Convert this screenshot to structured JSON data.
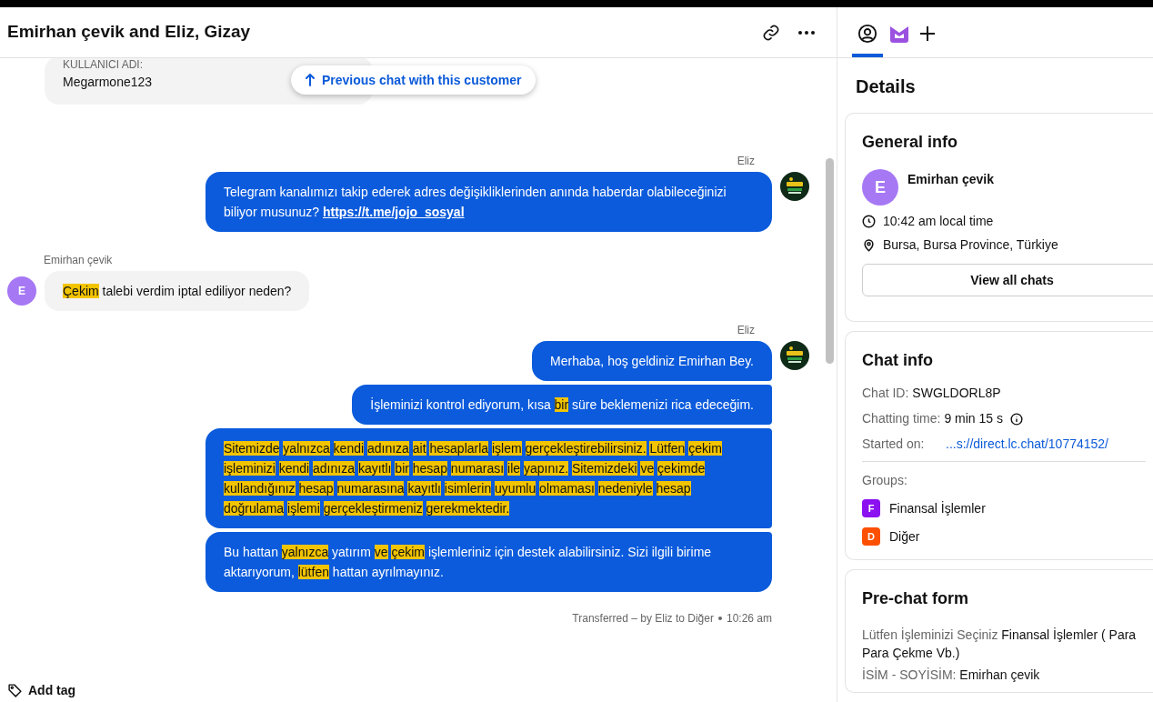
{
  "header": {
    "title": "Emirhan çevik and Eliz, Gizay"
  },
  "previous_message": {
    "label": "KULLANICI ADI:",
    "value": "Megarmone123"
  },
  "previous_chat_button": {
    "label": "Previous chat with this customer"
  },
  "messages": [
    {
      "kind": "agent",
      "author": "Eliz",
      "text": "Telegram kanalımızı takip ederek adres değişikliklerinden anında haberdar olabileceğinizi biliyor musunuz?",
      "link": "https://t.me/jojo_sosyal"
    },
    {
      "kind": "customer",
      "author": "Emirhan çevik",
      "initial": "E",
      "words": [
        {
          "text": "Çekim",
          "highlighted": true
        },
        {
          "text": "talebi",
          "highlighted": false
        },
        {
          "text": "verdim",
          "highlighted": false
        },
        {
          "text": "iptal",
          "highlighted": false
        },
        {
          "text": "ediliyor",
          "highlighted": false
        },
        {
          "text": "neden?",
          "highlighted": false
        }
      ]
    },
    {
      "kind": "agent",
      "author": "Eliz",
      "text": "Merhaba, hoş geldiniz Emirhan Bey."
    },
    {
      "kind": "agent",
      "words": [
        {
          "text": "İşleminizi kontrol ediyorum, kısa",
          "highlighted": false
        },
        {
          "text": "bir",
          "highlighted": true
        },
        {
          "text": "süre beklemenizi rica edeceğim.",
          "highlighted": false
        }
      ]
    },
    {
      "kind": "agent",
      "highlight_all_words": true,
      "text": "Sitemizde yalnızca kendi adınıza ait hesaplarla işlem gerçekleştirebilirsiniz. Lütfen çekim işleminizi kendi adınıza kayıtlı bir hesap numarası ile yapınız. Sitemizdeki ve çekimde kullandığınız hesap numarasına kayıtlı isimlerin uyumlu olmaması nedeniyle hesap doğrulama işlemi gerçekleştirmeniz gerekmektedir."
    },
    {
      "kind": "agent",
      "words": [
        {
          "text": "Bu hattan",
          "highlighted": false
        },
        {
          "text": "yalnızca",
          "highlighted": true
        },
        {
          "text": "yatırım",
          "highlighted": false
        },
        {
          "text": "ve",
          "highlighted": true
        },
        {
          "text": "çekim",
          "highlighted": true
        },
        {
          "text": "işlemleriniz için destek alabilirsiniz. Sizi ilgili birime aktarıyorum,",
          "highlighted": false
        },
        {
          "text": "lütfen",
          "highlighted": true
        },
        {
          "text": "hattan ayrılmayınız.",
          "highlighted": false
        }
      ]
    },
    {
      "kind": "event",
      "text": "Transferred – by Eliz to Diğer",
      "time": "10:26 am"
    }
  ],
  "add_tag": {
    "label": "Add tag"
  },
  "sidebar": {
    "tabs": [
      {
        "kind": "customer",
        "selected": true
      },
      {
        "kind": "app",
        "selected": false
      },
      {
        "kind": "add",
        "selected": false
      }
    ],
    "title": "Details",
    "general_info": {
      "title": "General info",
      "initial": "E",
      "name": "Emirhan çevik",
      "local_time": "10:42 am local time",
      "location": "Bursa, Bursa Province, Türkiye",
      "button": "View all chats"
    },
    "chat_info": {
      "title": "Chat info",
      "rows": [
        {
          "label": "Chat ID:",
          "value": "SWGLDORL8P"
        },
        {
          "label": "Chatting time:",
          "value": "9 min 15 s",
          "info": true
        },
        {
          "label": "Started on:",
          "value": "...s://direct.lc.chat/10774152/",
          "link": true
        }
      ],
      "groups_label": "Groups:",
      "groups": [
        {
          "initial": "F",
          "name": "Finansal İşlemler",
          "color": "#8b11f0"
        },
        {
          "initial": "D",
          "name": "Diğer",
          "color": "#fe5000"
        }
      ]
    },
    "pre_chat_form": {
      "title": "Pre-chat form",
      "fields": [
        {
          "label": "Lütfen İşleminizi Seçiniz",
          "value": "Finansal İşlemler ( Para Para Çekme Vb.)"
        },
        {
          "label": "İSİM - SOYİSİM:",
          "value": "Emirhan çevik"
        }
      ]
    }
  }
}
